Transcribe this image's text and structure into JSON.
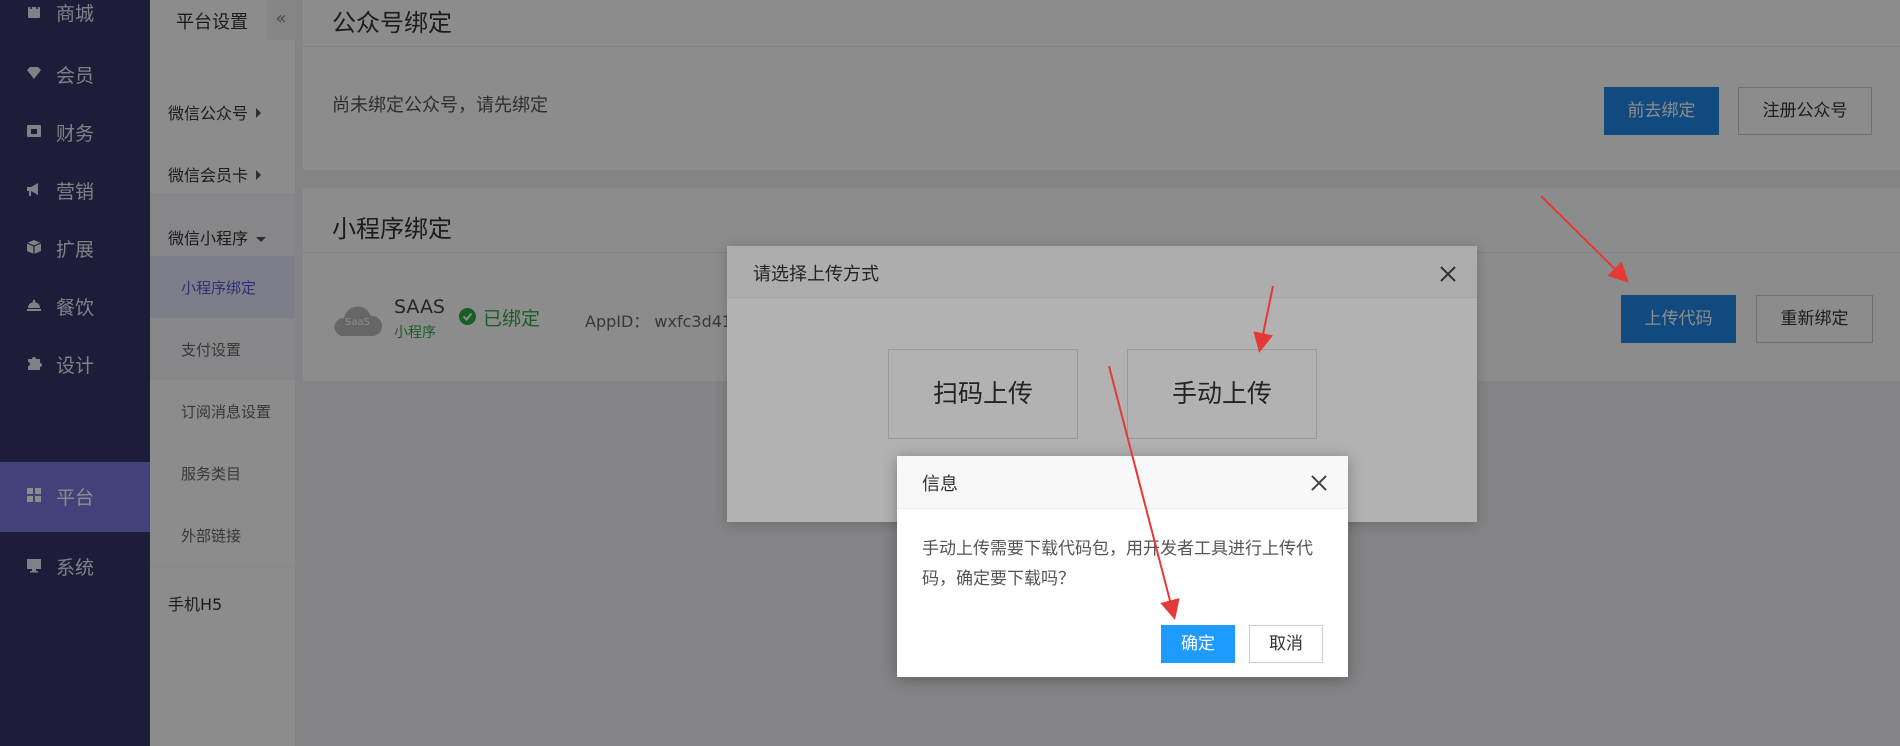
{
  "sidebar": {
    "items": [
      {
        "label": "商城",
        "icon": "bag-icon"
      },
      {
        "label": "会员",
        "icon": "diamond-icon"
      },
      {
        "label": "财务",
        "icon": "wallet-icon"
      },
      {
        "label": "营销",
        "icon": "megaphone-icon"
      },
      {
        "label": "扩展",
        "icon": "box-icon"
      },
      {
        "label": "餐饮",
        "icon": "dish-icon"
      },
      {
        "label": "设计",
        "icon": "puzzle-icon"
      },
      {
        "label": "平台",
        "icon": "grid-icon"
      },
      {
        "label": "系统",
        "icon": "monitor-icon"
      }
    ]
  },
  "submenu": {
    "title": "平台设置",
    "collapse": "«",
    "items": [
      "微信公众号",
      "微信会员卡",
      "微信小程序"
    ],
    "children": [
      "小程序绑定",
      "支付设置",
      "订阅消息设置",
      "服务类目",
      "外部链接"
    ],
    "last": "手机H5"
  },
  "gzh": {
    "title": "公众号绑定",
    "notice": "尚未绑定公众号，请先绑定",
    "btn_bind": "前去绑定",
    "btn_register": "注册公众号"
  },
  "mp": {
    "title": "小程序绑定",
    "logo_text": "SaaS",
    "name": "SAAS",
    "type": "小程序",
    "status": "已绑定",
    "appid_label": "AppID：",
    "appid_value": "wxfc3d41a",
    "btn_upload": "上传代码",
    "btn_rebind": "重新绑定"
  },
  "dialog_upload": {
    "title": "请选择上传方式",
    "option_scan": "扫码上传",
    "option_manual": "手动上传"
  },
  "dialog_info": {
    "title": "信息",
    "message": "手动上传需要下载代码包，用开发者工具进行上传代码，确定要下载吗？",
    "confirm": "确定",
    "cancel": "取消"
  },
  "colors": {
    "sidebar_bg": "#363468",
    "sidebar_active": "#7b77dd",
    "primary": "#1e88e5",
    "success": "#2eab45",
    "annotation_arrow": "#e53935"
  }
}
